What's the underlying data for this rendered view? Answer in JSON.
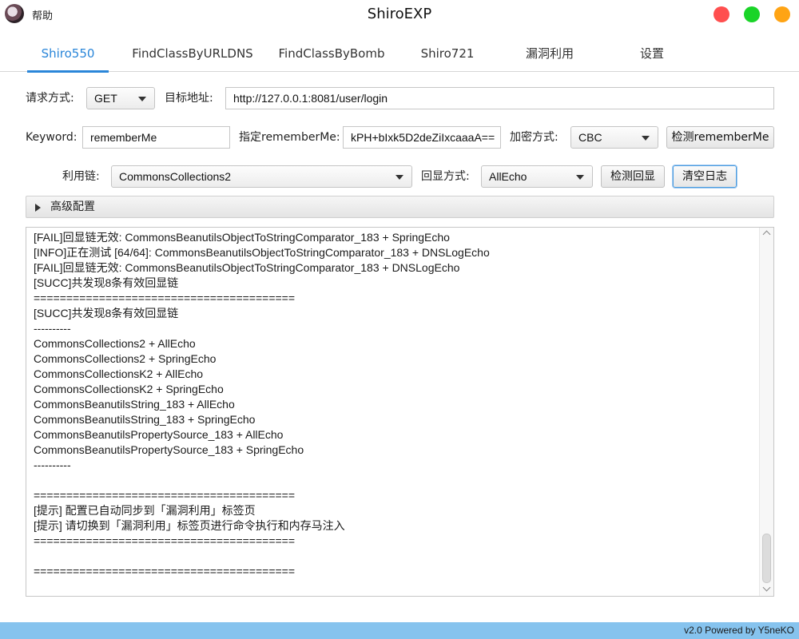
{
  "app": {
    "title": "ShiroEXP",
    "menu_help": "帮助"
  },
  "window_controls": {
    "close_color": "#ff4f4f",
    "maximize_color": "#1ad428",
    "minimize_color": "#ffa414"
  },
  "tabs": [
    {
      "label": "Shiro550",
      "active": true
    },
    {
      "label": "FindClassByURLDNS",
      "active": false
    },
    {
      "label": "FindClassByBomb",
      "active": false
    },
    {
      "label": "Shiro721",
      "active": false
    },
    {
      "label": "漏洞利用",
      "active": false
    },
    {
      "label": "设置",
      "active": false
    }
  ],
  "form": {
    "method_label": "请求方式:",
    "method_value": "GET",
    "target_label": "目标地址:",
    "target_value": "http://127.0.0.1:8081/user/login",
    "keyword_label": "Keyword:",
    "keyword_value": "rememberMe",
    "specify_label": "指定rememberMe:",
    "specify_value": "kPH+bIxk5D2deZiIxcaaaA==",
    "encrypt_label": "加密方式:",
    "encrypt_value": "CBC",
    "detect_rememberme_button": "检测rememberMe",
    "chain_label": "利用链:",
    "chain_value": "CommonsCollections2",
    "echo_label": "回显方式:",
    "echo_value": "AllEcho",
    "detect_echo_button": "检测回显",
    "clear_log_button": "清空日志"
  },
  "advanced": {
    "label": "高级配置"
  },
  "log_lines": [
    "[FAIL]回显链无效: CommonsBeanutilsObjectToStringComparator_183 + SpringEcho",
    "[INFO]正在测试 [64/64]: CommonsBeanutilsObjectToStringComparator_183 + DNSLogEcho",
    "[FAIL]回显链无效: CommonsBeanutilsObjectToStringComparator_183 + DNSLogEcho",
    "[SUCC]共发现8条有效回显链",
    "========================================",
    "[SUCC]共发现8条有效回显链",
    "----------",
    "CommonsCollections2 + AllEcho",
    "CommonsCollections2 + SpringEcho",
    "CommonsCollectionsK2 + AllEcho",
    "CommonsCollectionsK2 + SpringEcho",
    "CommonsBeanutilsString_183 + AllEcho",
    "CommonsBeanutilsString_183 + SpringEcho",
    "CommonsBeanutilsPropertySource_183 + AllEcho",
    "CommonsBeanutilsPropertySource_183 + SpringEcho",
    "----------",
    "",
    "========================================",
    "[提示] 配置已自动同步到「漏洞利用」标签页",
    "[提示] 请切换到「漏洞利用」标签页进行命令执行和内存马注入",
    "========================================",
    "",
    "========================================"
  ],
  "status_bar": {
    "text": "v2.0 Powered by Y5neKO",
    "color": "#86c3ee"
  },
  "accent_color": "#2a86d9"
}
